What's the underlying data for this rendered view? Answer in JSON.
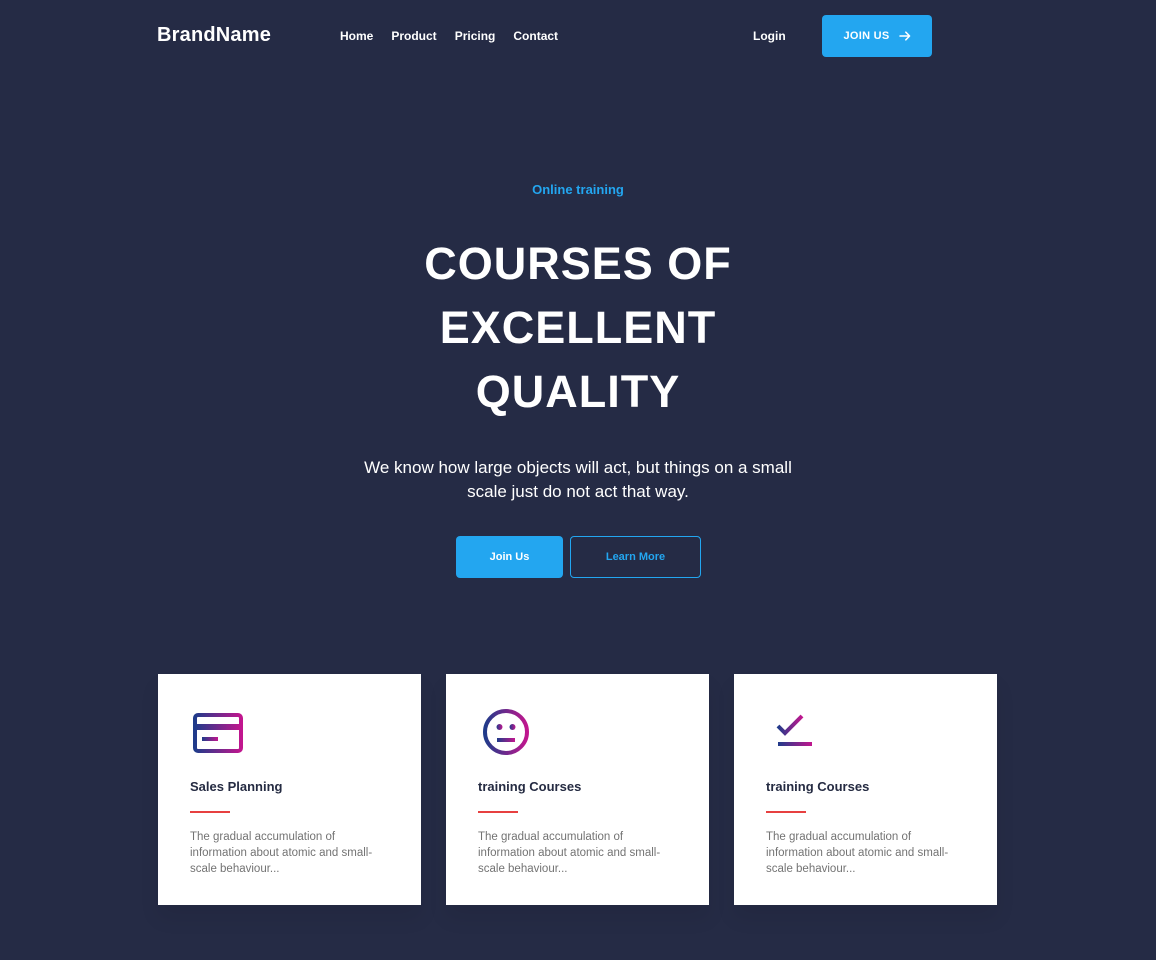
{
  "header": {
    "brand": "BrandName",
    "nav": [
      "Home",
      "Product",
      "Pricing",
      "Contact"
    ],
    "login": "Login",
    "join_label": "JOIN US"
  },
  "hero": {
    "eyebrow": "Online training",
    "title_lines": [
      "COURSES OF",
      "EXCELLENT",
      "QUALITY"
    ],
    "subtitle": "We know how large objects will act, but things on a small scale just do not act that way.",
    "primary_label": "Join Us",
    "secondary_label": "Learn More"
  },
  "cards": [
    {
      "icon": "credit-card-icon",
      "title": "Sales Planning",
      "text": "The gradual accumulation of information about atomic and small-scale behaviour..."
    },
    {
      "icon": "neutral-face-icon",
      "title": "training Courses",
      "text": "The gradual accumulation of information about atomic and small-scale behaviour..."
    },
    {
      "icon": "checkmark-icon",
      "title": "training Courses",
      "text": "The gradual accumulation of information about atomic and small-scale behaviour..."
    }
  ],
  "colors": {
    "background": "#252b45",
    "accent": "#23a6f0",
    "card_line": "#e74040",
    "card_title": "#252b42",
    "card_text": "#737373",
    "icon_gradient_start": "#1f3b8a",
    "icon_gradient_end": "#c1168e"
  }
}
